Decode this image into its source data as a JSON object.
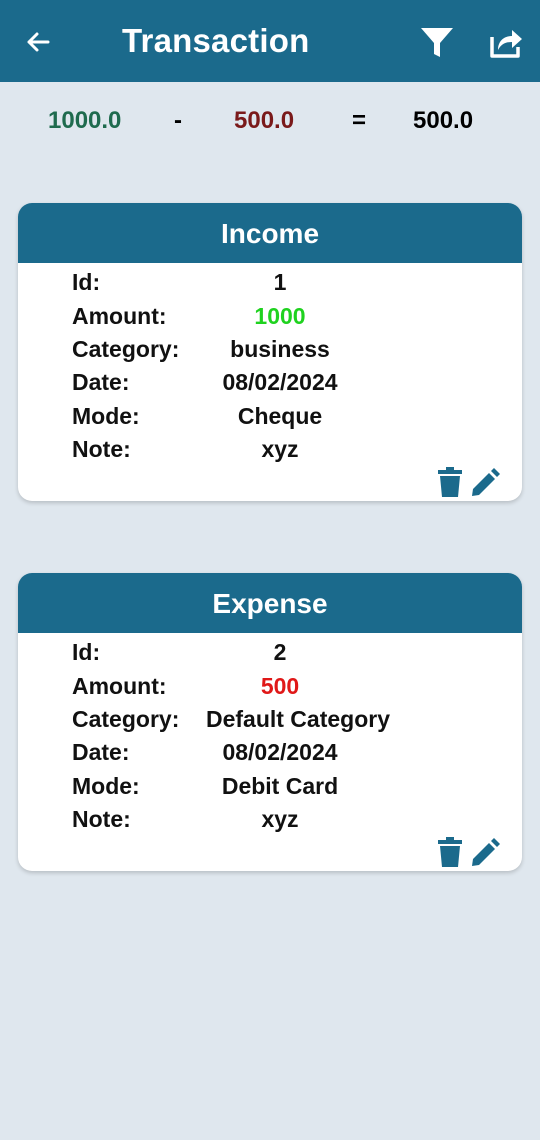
{
  "appbar": {
    "title": "Transaction",
    "icons": [
      "back-arrow-icon",
      "filter-icon",
      "share-icon"
    ],
    "color": "#1b6a8c"
  },
  "summary": {
    "income": "1000.0",
    "minus": "-",
    "expense": "500.0",
    "equals": "=",
    "balance": "500.0",
    "income_color": "#1f6b4e",
    "expense_color": "#7a1a1a"
  },
  "cards": [
    {
      "title": "Income",
      "labels": [
        "Id:",
        "Amount:",
        "Category:",
        "Date:",
        "Mode:",
        "Note:"
      ],
      "id": "1",
      "amount": "1000",
      "category": "business",
      "date": "08/02/2024",
      "mode": "Cheque",
      "note": "xyz",
      "amount_color": "#1fd21f"
    },
    {
      "title": "Expense",
      "labels": [
        "Id:",
        "Amount:",
        "Category:",
        "Date:",
        "Mode:",
        "Note:"
      ],
      "id": "2",
      "amount": "500",
      "category": "Default Category",
      "date": "08/02/2024",
      "mode": "Debit Card",
      "note": "xyz",
      "amount_color": "#e01818"
    }
  ],
  "card_icons": [
    "trash-icon",
    "edit-icon"
  ]
}
